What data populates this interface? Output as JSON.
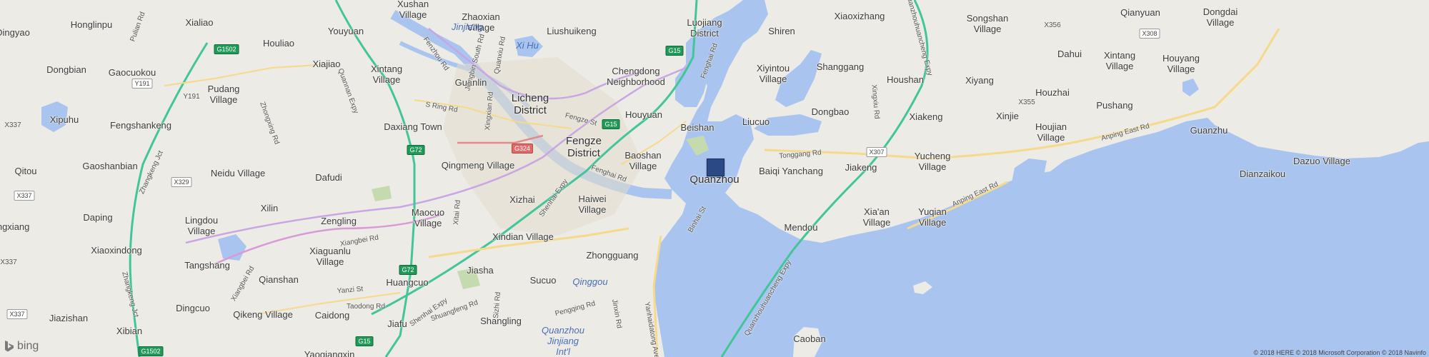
{
  "map": {
    "colors": {
      "land": "#ecebe6",
      "water": "#a9c4ee",
      "highway": "#43c59a",
      "arterial": "#f6d98a",
      "rail": "#c9a6e3"
    },
    "labels": [
      {
        "id": "honglinpu",
        "text": "Honglinpu",
        "kind": "place"
      },
      {
        "id": "xialiao",
        "text": "Xialiao",
        "kind": "place"
      },
      {
        "id": "youyuan",
        "text": "Youyuan",
        "kind": "place"
      },
      {
        "id": "xushan-village",
        "text": "Xushan\nVillage",
        "kind": "place"
      },
      {
        "id": "zhaoxian-village",
        "text": "Zhaoxian\nVillage",
        "kind": "place"
      },
      {
        "id": "liushuikeng",
        "text": "Liushuikeng",
        "kind": "place"
      },
      {
        "id": "luojiang-district",
        "text": "Luojiang\nDistrict",
        "kind": "place"
      },
      {
        "id": "shiren",
        "text": "Shiren",
        "kind": "place"
      },
      {
        "id": "xiaoxizhang",
        "text": "Xiaoxizhang",
        "kind": "place"
      },
      {
        "id": "songshan-village",
        "text": "Songshan\nVillage",
        "kind": "place"
      },
      {
        "id": "qianyuan",
        "text": "Qianyuan",
        "kind": "place"
      },
      {
        "id": "dongdai-village",
        "text": "Dongdai\nVillage",
        "kind": "place"
      },
      {
        "id": "dingyao",
        "text": "Dingyao",
        "kind": "place"
      },
      {
        "id": "houliao",
        "text": "Houliao",
        "kind": "place"
      },
      {
        "id": "dongbian",
        "text": "Dongbian",
        "kind": "place"
      },
      {
        "id": "gaocuokou",
        "text": "Gaocuokou",
        "kind": "place"
      },
      {
        "id": "xiajiao",
        "text": "Xiajiao",
        "kind": "place"
      },
      {
        "id": "xintang-village",
        "text": "Xintang\nVillage",
        "kind": "place"
      },
      {
        "id": "guanlin",
        "text": "Guanlin",
        "kind": "place"
      },
      {
        "id": "licheng-district",
        "text": "Licheng\nDistrict",
        "kind": "major"
      },
      {
        "id": "chengdong-neighborhood",
        "text": "Chengdong\nNeighborhood",
        "kind": "place"
      },
      {
        "id": "xiyintou-village",
        "text": "Xiyintou\nVillage",
        "kind": "place"
      },
      {
        "id": "shanggang",
        "text": "Shanggang",
        "kind": "place"
      },
      {
        "id": "houshan",
        "text": "Houshan",
        "kind": "place"
      },
      {
        "id": "dahui",
        "text": "Dahui",
        "kind": "place"
      },
      {
        "id": "xintang-village-2",
        "text": "Xintang\nVillage",
        "kind": "place"
      },
      {
        "id": "houyang-village",
        "text": "Houyang\nVillage",
        "kind": "place"
      },
      {
        "id": "pudang-village",
        "text": "Pudang\nVillage",
        "kind": "place"
      },
      {
        "id": "xiyang",
        "text": "Xiyang",
        "kind": "place"
      },
      {
        "id": "houzhai",
        "text": "Houzhai",
        "kind": "place"
      },
      {
        "id": "xipuhu",
        "text": "Xipuhu",
        "kind": "place"
      },
      {
        "id": "fengshankeng",
        "text": "Fengshankeng",
        "kind": "place"
      },
      {
        "id": "daxiang-town",
        "text": "Daxiang Town",
        "kind": "place"
      },
      {
        "id": "houyuan",
        "text": "Houyuan",
        "kind": "place"
      },
      {
        "id": "beishan",
        "text": "Beishan",
        "kind": "place"
      },
      {
        "id": "liucuo",
        "text": "Liucuo",
        "kind": "place"
      },
      {
        "id": "dongbao",
        "text": "Dongbao",
        "kind": "place"
      },
      {
        "id": "xiakeng",
        "text": "Xiakeng",
        "kind": "place"
      },
      {
        "id": "xinjie",
        "text": "Xinjie",
        "kind": "place"
      },
      {
        "id": "houjian-village",
        "text": "Houjian\nVillage",
        "kind": "place"
      },
      {
        "id": "pushang",
        "text": "Pushang",
        "kind": "place"
      },
      {
        "id": "guanzhu",
        "text": "Guanzhu",
        "kind": "place"
      },
      {
        "id": "fengze-district",
        "text": "Fengze\nDistrict",
        "kind": "major"
      },
      {
        "id": "baoshan-village",
        "text": "Baoshan\nVillage",
        "kind": "place"
      },
      {
        "id": "qitou",
        "text": "Qitou",
        "kind": "place"
      },
      {
        "id": "gaoshanbian",
        "text": "Gaoshanbian",
        "kind": "place"
      },
      {
        "id": "qingmeng-village",
        "text": "Qingmeng Village",
        "kind": "place"
      },
      {
        "id": "neidu-village",
        "text": "Neidu Village",
        "kind": "place"
      },
      {
        "id": "dafudi",
        "text": "Dafudi",
        "kind": "place"
      },
      {
        "id": "baiqi-yanchang",
        "text": "Baiqi Yanchang",
        "kind": "place"
      },
      {
        "id": "jiakeng",
        "text": "Jiakeng",
        "kind": "place"
      },
      {
        "id": "yucheng-village",
        "text": "Yucheng\nVillage",
        "kind": "place"
      },
      {
        "id": "quanzhou",
        "text": "Quanzhou",
        "kind": "major"
      },
      {
        "id": "dianzaikou",
        "text": "Dianzaikou",
        "kind": "place"
      },
      {
        "id": "dazuo-village",
        "text": "Dazuo Village",
        "kind": "place"
      },
      {
        "id": "xizhai",
        "text": "Xizhai",
        "kind": "place"
      },
      {
        "id": "haiwei-village",
        "text": "Haiwei\nVillage",
        "kind": "place"
      },
      {
        "id": "xilin",
        "text": "Xilin",
        "kind": "place"
      },
      {
        "id": "maocuo-village",
        "text": "Maocuo\nVillage",
        "kind": "place"
      },
      {
        "id": "daping",
        "text": "Daping",
        "kind": "place"
      },
      {
        "id": "lingdou-village",
        "text": "Lingdou\nVillage",
        "kind": "place"
      },
      {
        "id": "zengling",
        "text": "Zengling",
        "kind": "place"
      },
      {
        "id": "xiaan-village",
        "text": "Xia'an\nVillage",
        "kind": "place"
      },
      {
        "id": "yuqian-village",
        "text": "Yuqian\nVillage",
        "kind": "place"
      },
      {
        "id": "mendou",
        "text": "Mendou",
        "kind": "place"
      },
      {
        "id": "jiangxiang",
        "text": "angxiang",
        "kind": "place"
      },
      {
        "id": "xiaoxindong",
        "text": "Xiaoxindong",
        "kind": "place"
      },
      {
        "id": "xiaguanlu-village",
        "text": "Xiaguanlu\nVillage",
        "kind": "place"
      },
      {
        "id": "xindian-village",
        "text": "Xindian Village",
        "kind": "place"
      },
      {
        "id": "zhongguang",
        "text": "Zhongguang",
        "kind": "place"
      },
      {
        "id": "tangshang",
        "text": "Tangshang",
        "kind": "place"
      },
      {
        "id": "jiasha",
        "text": "Jiasha",
        "kind": "place"
      },
      {
        "id": "sucuo",
        "text": "Sucuo",
        "kind": "place"
      },
      {
        "id": "qinggou",
        "text": "Qinggou",
        "kind": "water"
      },
      {
        "id": "qianshan",
        "text": "Qianshan",
        "kind": "place"
      },
      {
        "id": "huangcuo",
        "text": "Huangcuo",
        "kind": "place"
      },
      {
        "id": "dingcuo",
        "text": "Dingcuo",
        "kind": "place"
      },
      {
        "id": "qikeng-village",
        "text": "Qikeng Village",
        "kind": "place"
      },
      {
        "id": "caidong",
        "text": "Caidong",
        "kind": "place"
      },
      {
        "id": "jiazishan",
        "text": "Jiazishan",
        "kind": "place"
      },
      {
        "id": "xibian",
        "text": "Xibian",
        "kind": "place"
      },
      {
        "id": "jiafu",
        "text": "Jiafu",
        "kind": "place"
      },
      {
        "id": "shangling",
        "text": "Shangling",
        "kind": "place"
      },
      {
        "id": "yaoqiangxin",
        "text": "Yaoqiangxin",
        "kind": "place"
      },
      {
        "id": "caoban",
        "text": "Caoban",
        "kind": "place"
      },
      {
        "id": "xi-hu",
        "text": "Xi Hu",
        "kind": "water"
      },
      {
        "id": "jinjiang-river",
        "text": "Jinjiang",
        "kind": "water"
      },
      {
        "id": "quanzhou-airport",
        "text": "Quanzhou\nJinjiang\nInt'l\nAirport",
        "kind": "water"
      }
    ],
    "roads": [
      {
        "id": "pulian-rd",
        "text": "Pulian Rd"
      },
      {
        "id": "fenzhou-rd",
        "text": "Fenzhou Rd"
      },
      {
        "id": "jiangbin-south-rd",
        "text": "Jiangbin South Rd"
      },
      {
        "id": "quanxiu-rd",
        "text": "Quanxiu Rd"
      },
      {
        "id": "fenghai-rd-north",
        "text": "Fenghai Rd"
      },
      {
        "id": "quannan-expy",
        "text": "Quannan Expy"
      },
      {
        "id": "s-ring-rd",
        "text": "S Ring Rd"
      },
      {
        "id": "xingxian-rd",
        "text": "Xingxian Rd"
      },
      {
        "id": "fengze-st",
        "text": "Fengze St"
      },
      {
        "id": "zhangkeng-jct",
        "text": "Zhangkeng Jct"
      },
      {
        "id": "zhangkeng-jct-2",
        "text": "Zhangkeng Jct"
      },
      {
        "id": "zhongxing-rd",
        "text": "Zhongxing Rd"
      },
      {
        "id": "tonggang-rd",
        "text": "Tonggang Rd"
      },
      {
        "id": "fenghai-rd",
        "text": "Fenghai Rd"
      },
      {
        "id": "binhai-st",
        "text": "Binhai St"
      },
      {
        "id": "shenhai-expy",
        "text": "Shenhai Expy"
      },
      {
        "id": "shenhai-expy-2",
        "text": "Shenhai Expy"
      },
      {
        "id": "xiangbei-rd",
        "text": "Xiangbei Rd"
      },
      {
        "id": "xiangbei-rd-2",
        "text": "Xiangbei Rd"
      },
      {
        "id": "yanzi-st",
        "text": "Yanzi St"
      },
      {
        "id": "taodong-rd",
        "text": "Taodong Rd"
      },
      {
        "id": "shuangfeng-rd",
        "text": "Shuangfeng Rd"
      },
      {
        "id": "pengqing-rd",
        "text": "Pengqing Rd"
      },
      {
        "id": "jinxin-rd",
        "text": "Jinxin Rd"
      },
      {
        "id": "yanhaidatong-ave",
        "text": "Yanhaidatong Ave"
      },
      {
        "id": "quanzhouhuancheng-expy",
        "text": "Quanzhouhuancheng Expy"
      },
      {
        "id": "quanzhouhuancheng-expy-2",
        "text": "Quanzhouhuancheng Expy"
      },
      {
        "id": "anping-east-rd",
        "text": "Anping East Rd"
      },
      {
        "id": "anping-east-rd-2",
        "text": "Anping East Rd"
      },
      {
        "id": "xingxiu-rd",
        "text": "Xingxiu Rd"
      },
      {
        "id": "xitai-rd",
        "text": "Xitai Rd"
      },
      {
        "id": "sizhi-rd",
        "text": "Sizhi Rd"
      }
    ],
    "shields": [
      {
        "id": "g1502-top",
        "text": "G1502",
        "color": "green"
      },
      {
        "id": "g15-north",
        "text": "G15",
        "color": "green"
      },
      {
        "id": "y191",
        "text": "Y191",
        "color": "white"
      },
      {
        "id": "y191-label",
        "text": "Y191",
        "color": "none"
      },
      {
        "id": "g15-mid",
        "text": "G15",
        "color": "green"
      },
      {
        "id": "g324",
        "text": "G324",
        "color": "red"
      },
      {
        "id": "g72-north",
        "text": "G72",
        "color": "green"
      },
      {
        "id": "x337-a",
        "text": "X337",
        "color": "none"
      },
      {
        "id": "x337-b",
        "text": "X337",
        "color": "white"
      },
      {
        "id": "x329",
        "text": "X329",
        "color": "white"
      },
      {
        "id": "x307",
        "text": "X307",
        "color": "white"
      },
      {
        "id": "x355",
        "text": "X355",
        "color": "none"
      },
      {
        "id": "x308",
        "text": "X308",
        "color": "white"
      },
      {
        "id": "x356",
        "text": "X356",
        "color": "none"
      },
      {
        "id": "g72-south",
        "text": "G72",
        "color": "green"
      },
      {
        "id": "x337-c",
        "text": "X337",
        "color": "white"
      },
      {
        "id": "x337-d",
        "text": "X337",
        "color": "none"
      },
      {
        "id": "g15-south",
        "text": "G15",
        "color": "green"
      },
      {
        "id": "g1502-bottom",
        "text": "G1502",
        "color": "green"
      }
    ],
    "marker": {
      "name": "Quanzhou",
      "color": "#2b4a85"
    },
    "logo": {
      "text": "bing"
    },
    "copyright": "© 2018 HERE © 2018 Microsoft Corporation © 2018 Navinfo"
  }
}
